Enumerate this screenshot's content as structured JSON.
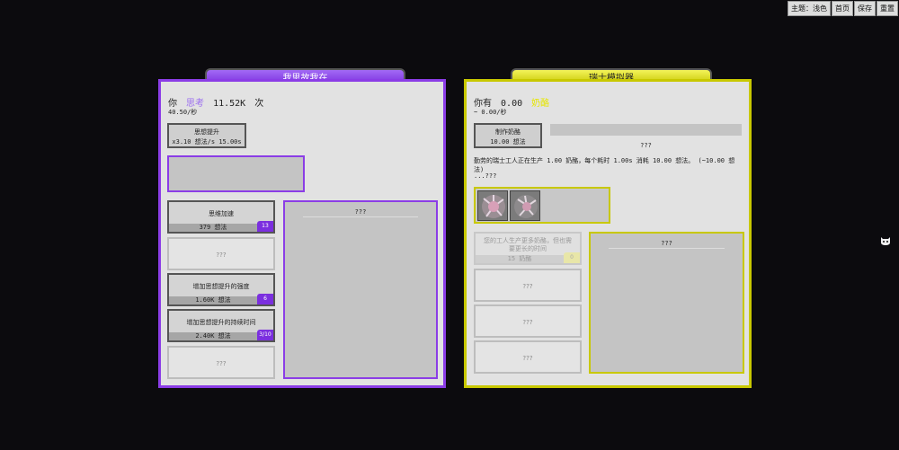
{
  "menu": {
    "theme": "主题：浅色",
    "home": "首页",
    "save": "保存",
    "reset": "重置"
  },
  "left": {
    "title": "我思故我在",
    "you": "你",
    "resource": "思考",
    "amount": "11.52K",
    "unit": "次",
    "rate": "40.50/秒",
    "boost": {
      "label": "思想提升",
      "detail": "x3.10 想法/s 15.00s"
    },
    "upgrades": [
      {
        "name": "思维加速",
        "cost": "379 想法",
        "level": "13"
      },
      {
        "locked": "???"
      },
      {
        "name": "增加思想提升的强度",
        "cost": "1.60K 想法",
        "level": "6"
      },
      {
        "name": "增加思想提升的持续时间",
        "cost": "2.40K 想法",
        "level": "3/10"
      },
      {
        "locked": "???"
      }
    ],
    "info": "???"
  },
  "right": {
    "title": "瑞士模拟器",
    "you": "你有",
    "amount": "0.00",
    "resource": "奶酪",
    "rate": "~ 0.00/秒",
    "make": {
      "label": "制作奶酪",
      "detail": "10.00 想法"
    },
    "progress_label": "???",
    "desc": "勤劳的瑞士工人正在生产 1.00 奶酪，每个耗时 1.00s 消耗 10.00 想法。 (~10.00 想法)",
    "desc2": "...???",
    "upgrades": [
      {
        "name": "您的工人生产更多奶酪，但也需要更长的时间",
        "cost": "15 奶酪",
        "level": "0"
      },
      {
        "locked": "???"
      },
      {
        "locked": "???"
      },
      {
        "locked": "???"
      }
    ],
    "info": "???"
  },
  "colors": {
    "purple": "#8b3de6",
    "yellow": "#c8c800"
  }
}
